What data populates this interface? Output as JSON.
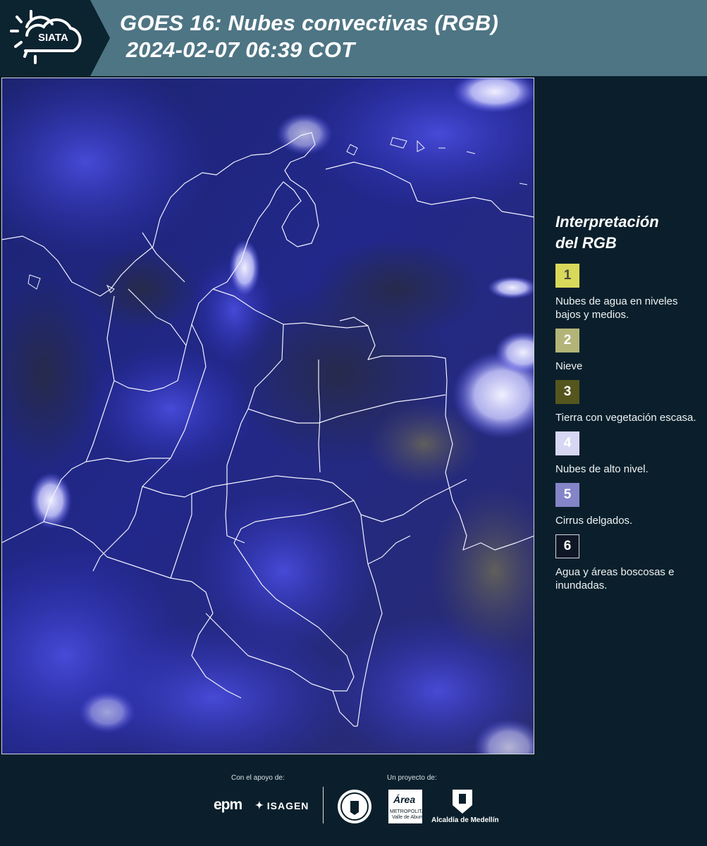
{
  "header": {
    "logo_text": "SIATA",
    "title_line1": "GOES 16: Nubes convectivas (RGB)",
    "title_line2": " 2024-02-07 06:39 COT"
  },
  "legend": {
    "title_line1": "Interpretación",
    "title_line2": "del RGB",
    "items": [
      {
        "num": "1",
        "label": "Nubes de agua en niveles bajos y medios.",
        "color": "#d8d95a",
        "text_color": "#4a4a3a"
      },
      {
        "num": "2",
        "label": "Nieve",
        "color": "#b3b477",
        "text_color": "#ffffff"
      },
      {
        "num": "3",
        "label": "Tierra con vegetación escasa.",
        "color": "#55561d",
        "text_color": "#ffffff"
      },
      {
        "num": "4",
        "label": "Nubes de alto nivel.",
        "color": "#d7d7f3",
        "text_color": "#ffffff"
      },
      {
        "num": "5",
        "label": "Cirrus delgados.",
        "color": "#8484c8",
        "text_color": "#ffffff"
      },
      {
        "num": "6",
        "label": "Agua y áreas boscosas e inundadas.",
        "color": "#0f1726",
        "text_color": "#ffffff"
      }
    ]
  },
  "footer": {
    "support_label": "Con el apoyo de:",
    "project_label": "Un proyecto de:",
    "sponsor1": "epm",
    "sponsor2": "ISAGEN",
    "partner_area": "Área",
    "partner_area_sub": "METROPOLITANA",
    "partner_area_sub2": "Valle de Aburrá",
    "partner_alcaldia": "Alcaldía de Medellín"
  },
  "colors": {
    "header_bg": "#4e7584",
    "panel_bg": "#0a1f2b",
    "map_base": "#141a4a"
  }
}
